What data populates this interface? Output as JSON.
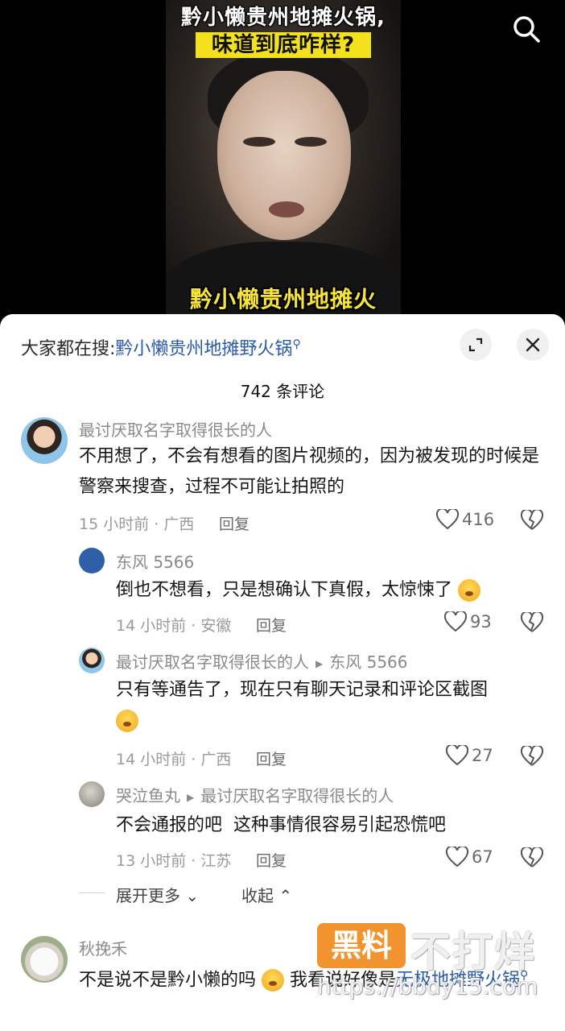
{
  "video": {
    "title_line1": "黔小懒贵州地摊火锅,",
    "title_line2": "味道到底咋样?",
    "subtitle": "黔小懒贵州地摊火"
  },
  "sheet": {
    "search_prefix": "大家都在搜:",
    "search_keyword": "黔小懒贵州地摊野火锅",
    "comment_count": "742 条评论",
    "reply_label": "回复"
  },
  "comments": [
    {
      "user": "最讨厌取名字取得很长的人",
      "text": "不用想了，不会有想看的图片视频的，因为被发现的时候是警察来搜查，过程不可能让拍照的",
      "time_place": "15 小时前 · 广西",
      "likes": "416"
    },
    {
      "user": "东风 5566",
      "text": "倒也不想看，只是想确认下真假，太惊悚了",
      "time_place": "14 小时前 · 安徽",
      "likes": "93"
    },
    {
      "user": "最讨厌取名字取得很长的人",
      "reply_to": "东风 5566",
      "text": "只有等通告了，现在只有聊天记录和评论区截图",
      "time_place": "14 小时前 · 广西",
      "likes": "27"
    },
    {
      "user": "哭泣鱼丸",
      "reply_to": "最讨厌取名字取得很长的人",
      "text": "不会通报的吧  这种事情很容易引起恐慌吧",
      "time_place": "13 小时前 · 江苏",
      "likes": "67"
    },
    {
      "user": "秋挽禾",
      "text_a": "不是说不是黔小懒的吗",
      "text_b": "我看说好像是",
      "link": "无极地摊野火锅"
    }
  ],
  "expand": {
    "more": "展开更多",
    "collapse": "收起"
  },
  "watermark": {
    "badge": "黑料",
    "text": "不打烊",
    "url": "https://bbdy15.com"
  },
  "colors": {
    "link": "#2a5aa8",
    "title_band": "#f3e11b",
    "watermark_badge": "#f08a1d"
  }
}
